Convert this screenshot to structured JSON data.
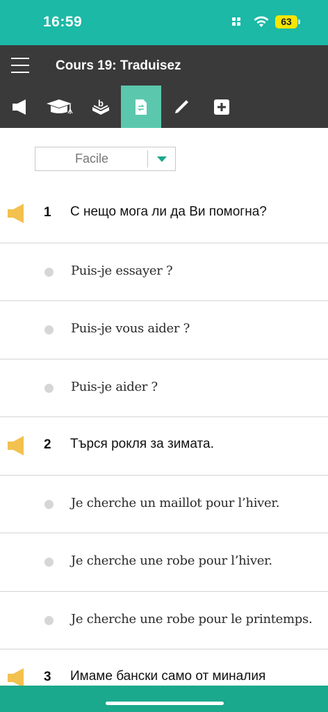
{
  "status_bar": {
    "time": "16:59",
    "battery": "63",
    "background": "#1bb9a6"
  },
  "header": {
    "title": "Cours 19: Traduisez",
    "background": "#3a3a3a",
    "menu_icon": "hamburger-icon",
    "tools": [
      {
        "icon": "speaker-icon",
        "active": false
      },
      {
        "icon": "graduation-cap-icon",
        "active": false
      },
      {
        "icon": "vocabulary-box-icon",
        "active": false
      },
      {
        "icon": "translate-document-icon",
        "active": true
      },
      {
        "icon": "pencil-icon",
        "active": false
      },
      {
        "icon": "plus-square-icon",
        "active": false
      }
    ],
    "active_color": "#5bc8ae"
  },
  "difficulty": {
    "value": "Facile",
    "arrow_color": "#1aa98c"
  },
  "questions": [
    {
      "number": "1",
      "text": "С нещо мога ли да Ви помогна?",
      "options": [
        "Puis-je essayer ?",
        "Puis-je vous aider ?",
        "Puis-je aider ?"
      ]
    },
    {
      "number": "2",
      "text": "Търся рокля за зимата.",
      "options": [
        "Je cherche un maillot pour l’hiver.",
        "Je cherche une robe pour l’hiver.",
        "Je cherche une robe pour le printemps."
      ]
    },
    {
      "number": "3",
      "text": "Имаме бански само от миналия",
      "options": []
    }
  ],
  "colors": {
    "speaker": "#f2c14e",
    "bottom_bar": "#1aa98c"
  }
}
